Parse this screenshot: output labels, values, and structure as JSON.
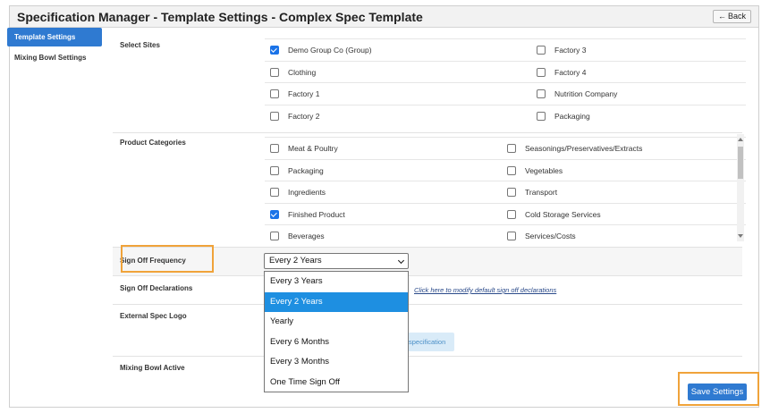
{
  "header": {
    "title": "Specification Manager - Template Settings - Complex Spec Template",
    "back_label": "Back",
    "back_icon": "arrow-left-icon"
  },
  "sidebar": {
    "items": [
      {
        "label": "Template Settings",
        "active": true
      },
      {
        "label": "Mixing Bowl Settings",
        "active": false
      }
    ]
  },
  "sections": {
    "select_sites": "Select Sites",
    "product_categories": "Product Categories",
    "sign_off_frequency": "Sign Off Frequency",
    "sign_off_declarations": "Sign Off Declarations",
    "external_spec_logo": "External Spec Logo",
    "mixing_bowl_active": "Mixing Bowl Active"
  },
  "sites": [
    [
      {
        "label": "Demo Group Co (Group)",
        "checked": true
      },
      {
        "label": "Factory 3",
        "checked": false
      }
    ],
    [
      {
        "label": "Clothing",
        "checked": false
      },
      {
        "label": "Factory 4",
        "checked": false
      }
    ],
    [
      {
        "label": "Factory 1",
        "checked": false
      },
      {
        "label": "Nutrition Company",
        "checked": false
      }
    ],
    [
      {
        "label": "Factory 2",
        "checked": false
      },
      {
        "label": "Packaging",
        "checked": false
      }
    ]
  ],
  "categories": [
    [
      {
        "label": "Meat & Poultry",
        "checked": false
      },
      {
        "label": "Seasonings/Preservatives/Extracts",
        "checked": false
      }
    ],
    [
      {
        "label": "Packaging",
        "checked": false
      },
      {
        "label": "Vegetables",
        "checked": false
      }
    ],
    [
      {
        "label": "Ingredients",
        "checked": false
      },
      {
        "label": "Transport",
        "checked": false
      }
    ],
    [
      {
        "label": "Finished Product",
        "checked": true
      },
      {
        "label": "Cold Storage Services",
        "checked": false
      }
    ],
    [
      {
        "label": "Beverages",
        "checked": false
      },
      {
        "label": "Services/Costs",
        "checked": false
      }
    ]
  ],
  "frequency": {
    "selected": "Every 2 Years",
    "options": [
      "Every 3 Years",
      "Every 2 Years",
      "Yearly",
      "Every 6 Months",
      "Every 3 Months",
      "One Time Sign Off"
    ],
    "highlighted_index": 1
  },
  "declarations_link": "Click here to modify default sign off declarations",
  "logo_button_partial": "specification",
  "save_label": "Save Settings",
  "colors": {
    "accent": "#2f7ad1",
    "highlight_box": "#f0a33a",
    "selected_option": "#1e8fe1"
  }
}
